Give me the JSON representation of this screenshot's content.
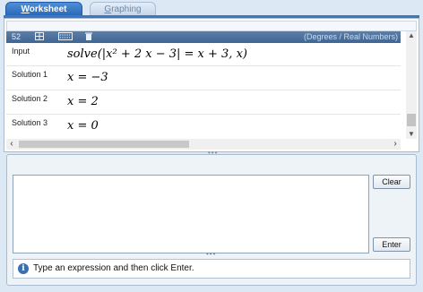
{
  "tabs": [
    {
      "label_first": "W",
      "label_rest": "orksheet",
      "active": true
    },
    {
      "label_first": "G",
      "label_rest": "raphing",
      "active": false
    }
  ],
  "worksheet": {
    "toolbar": {
      "font_size": "52",
      "mode": "(Degrees / Real Numbers)"
    },
    "rows": [
      {
        "label": "Input",
        "expr": "solve(|x² + 2 x − 3| = x + 3, x)"
      },
      {
        "label": "Solution 1",
        "expr": "x = −3"
      },
      {
        "label": "Solution 2",
        "expr": "x = 2"
      },
      {
        "label": "Solution 3",
        "expr": "x = 0"
      }
    ]
  },
  "entry": {
    "clear_label": "Clear",
    "enter_label": "Enter",
    "input_value": "",
    "status_text": "Type an expression and then click Enter."
  },
  "icons": [
    "grid-icon",
    "keyboard-icon",
    "trash-icon",
    "info-icon"
  ]
}
